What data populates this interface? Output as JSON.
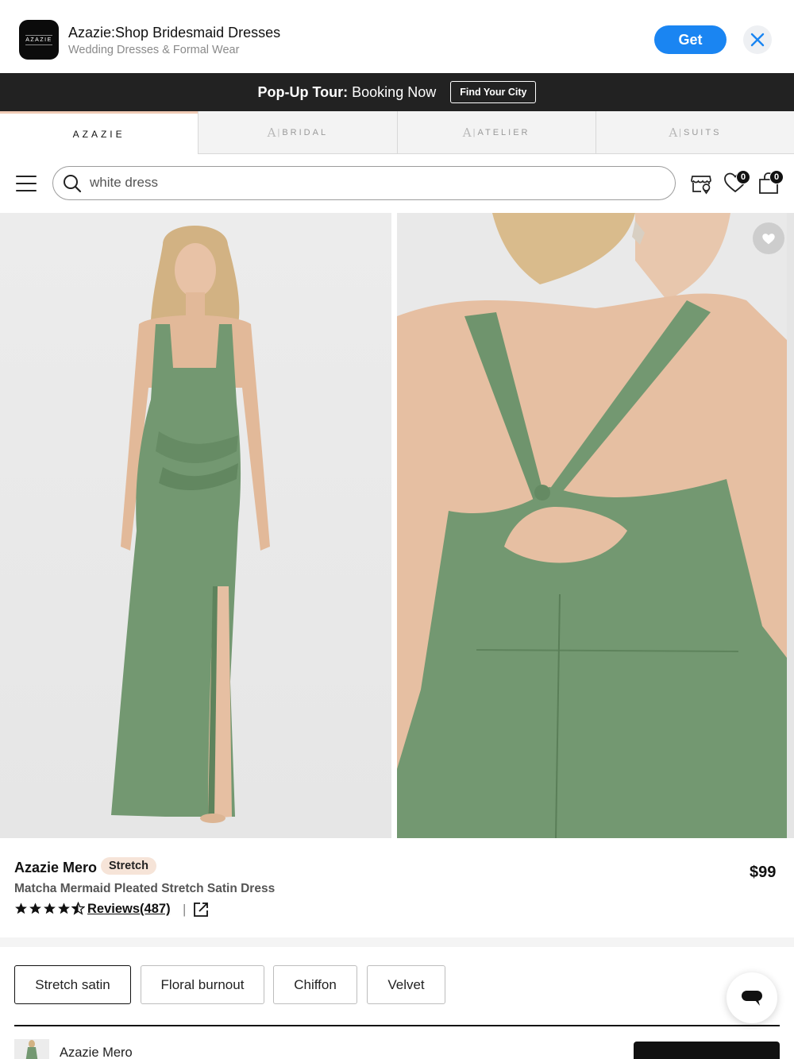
{
  "app_banner": {
    "icon_text": "AZAZIE",
    "title": "Azazie:Shop Bridesmaid Dresses",
    "subtitle": "Wedding Dresses & Formal Wear",
    "get_label": "Get"
  },
  "promo": {
    "bold": "Pop-Up Tour:",
    "text": " Booking Now",
    "button": "Find Your City"
  },
  "brand_tabs": [
    {
      "label": "AZAZIE",
      "active": true
    },
    {
      "label": "BRIDAL",
      "active": false
    },
    {
      "label": "ATELIER",
      "active": false
    },
    {
      "label": "SUITS",
      "active": false
    }
  ],
  "search": {
    "value": "white dress"
  },
  "header_icons": {
    "wishlist_count": "0",
    "cart_count": "0"
  },
  "product": {
    "name": "Azazie Mero",
    "tag": "Stretch",
    "price": "$99",
    "description": "Matcha Mermaid Pleated Stretch Satin Dress",
    "rating": 4.5,
    "reviews_label": "Reviews(487)",
    "separator": "|"
  },
  "fabrics": [
    {
      "label": "Stretch satin",
      "selected": true
    },
    {
      "label": "Floral burnout",
      "selected": false
    },
    {
      "label": "Chiffon",
      "selected": false
    },
    {
      "label": "Velvet",
      "selected": false
    }
  ],
  "sticky_bar": {
    "name": "Azazie Mero"
  },
  "colors": {
    "dress": "#739871",
    "accent_blue": "#1a85f2",
    "tag_bg": "#f6e4d8",
    "promo_bg": "#222222"
  }
}
